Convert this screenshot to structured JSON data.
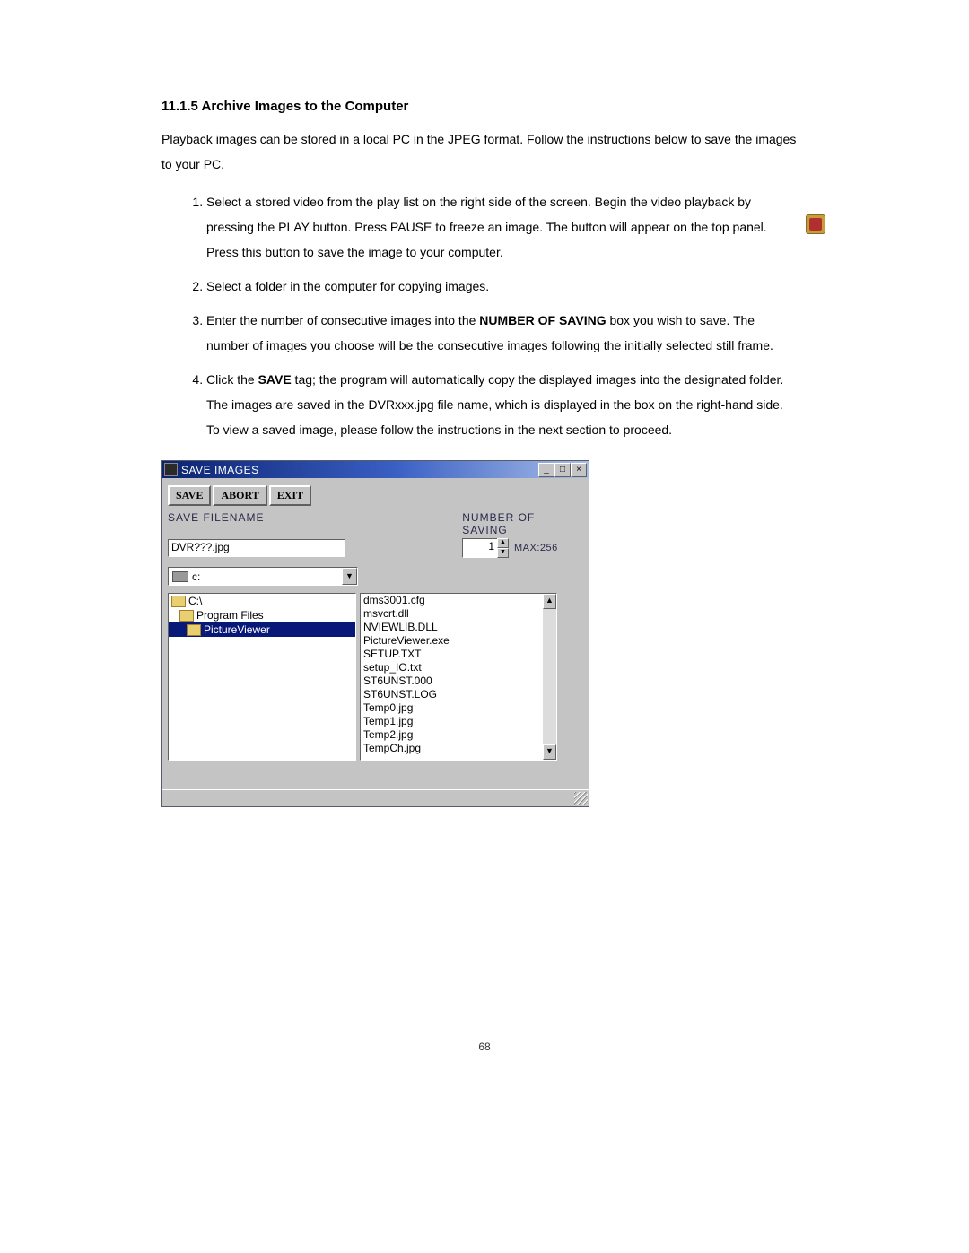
{
  "section": {
    "number": "11.1.5",
    "title": "Archive Images to the Computer",
    "intro": "Playback images can be stored in a local PC in the JPEG format. Follow the instructions below to save the images to your PC.",
    "steps": {
      "s1a": "Select a stored video from the play list on the right side of the screen. Begin the video playback by pressing the PLAY button. Press PAUSE to freeze an image. The",
      "s1b": "button will appear on the top panel. Press this button to save the image to your computer.",
      "s2": "Select a folder in the computer for copying images.",
      "s3a": "Enter the number of consecutive images into the ",
      "s3b": "NUMBER OF SAVING",
      "s3c": " box you wish to save. The number of images you choose will be the consecutive images following the initially selected still frame.",
      "s4a": "Click the ",
      "s4b": "SAVE",
      "s4c": " tag; the program will automatically copy the displayed images into the designated folder. The images are saved in the DVRxxx.jpg file name, which is displayed in the box on the right-hand side. To view a saved image, please follow the instructions in the next section to proceed."
    }
  },
  "dialog": {
    "title": "SAVE IMAGES",
    "buttons": {
      "save": "SAVE",
      "abort": "ABORT",
      "exit": "EXIT"
    },
    "labels": {
      "filename": "SAVE FILENAME",
      "numsaving": "NUMBER OF SAVING",
      "max": "MAX:256"
    },
    "values": {
      "filename": "DVR???.jpg",
      "num": "1",
      "drive": "c:"
    },
    "folders": {
      "f0": "C:\\",
      "f1": "Program Files",
      "f2": "PictureViewer"
    },
    "files": {
      "f0": "dms3001.cfg",
      "f1": "msvcrt.dll",
      "f2": "NVIEWLIB.DLL",
      "f3": "PictureViewer.exe",
      "f4": "SETUP.TXT",
      "f5": "setup_IO.txt",
      "f6": "ST6UNST.000",
      "f7": "ST6UNST.LOG",
      "f8": "Temp0.jpg",
      "f9": "Temp1.jpg",
      "f10": "Temp2.jpg",
      "f11": "TempCh.jpg"
    }
  },
  "page_number": "68"
}
